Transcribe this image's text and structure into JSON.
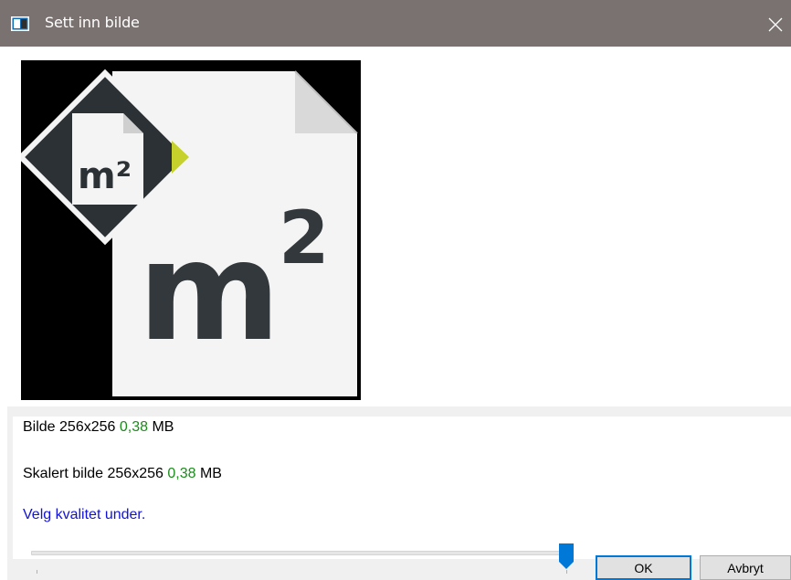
{
  "window": {
    "title": "Sett inn bilde",
    "icon": "app-image-icon",
    "close_icon": "close-icon"
  },
  "preview": {
    "badge_text": "m²",
    "large_text": "m",
    "large_sup": "2",
    "accent_color": "#c6d22b"
  },
  "info": {
    "original_label": "Bilde 256x256",
    "original_size": "0,38",
    "original_unit": "MB",
    "scaled_label": "Skalert bilde 256x256",
    "scaled_size": "0,38",
    "scaled_unit": "MB",
    "hint": "Velg kvalitet under."
  },
  "quality_slider": {
    "value_fraction": 0.99
  },
  "buttons": {
    "ok": "OK",
    "cancel": "Avbryt"
  },
  "colors": {
    "titlebar": "#7a7270",
    "size_green": "#1b8c1b",
    "hint_blue": "#1212d6",
    "focus_blue": "#0078d7"
  }
}
